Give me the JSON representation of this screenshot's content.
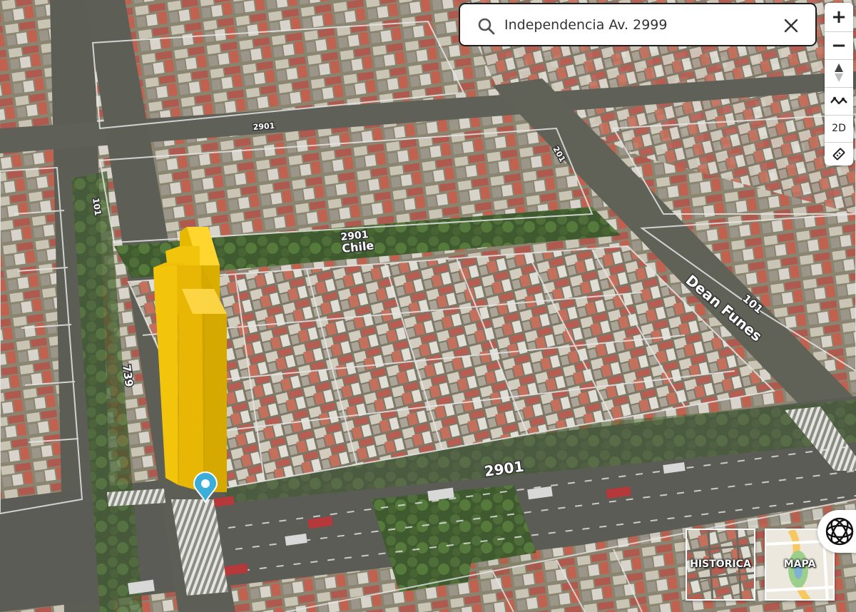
{
  "search": {
    "value": "Independencia Av. 2999",
    "placeholder": ""
  },
  "map_controls": {
    "zoom_in": "+",
    "zoom_out": "−",
    "view_mode": "2D"
  },
  "map_labels": {
    "street_chile": "Chile",
    "number_chile": "2901",
    "street_dean_funes": "Dean Funes",
    "number_dean_funes": "101",
    "number_independencia": "2901",
    "number_left_street": "739",
    "number_top_left": "101",
    "number_top_street": "2901",
    "number_right_street": "201"
  },
  "layers": {
    "historic": "HISTORICA",
    "map": "MAPA"
  },
  "colors": {
    "building_highlight": "#f2c40c",
    "marker": "#3aaed8",
    "sidewalk_lines": "#e8e8e8"
  },
  "icons": {
    "search": "search-icon",
    "clear": "close-icon",
    "compass": "compass-icon",
    "profile": "elevation-profile-icon",
    "ruler": "measure-icon",
    "logo": "app-logo-icon"
  }
}
